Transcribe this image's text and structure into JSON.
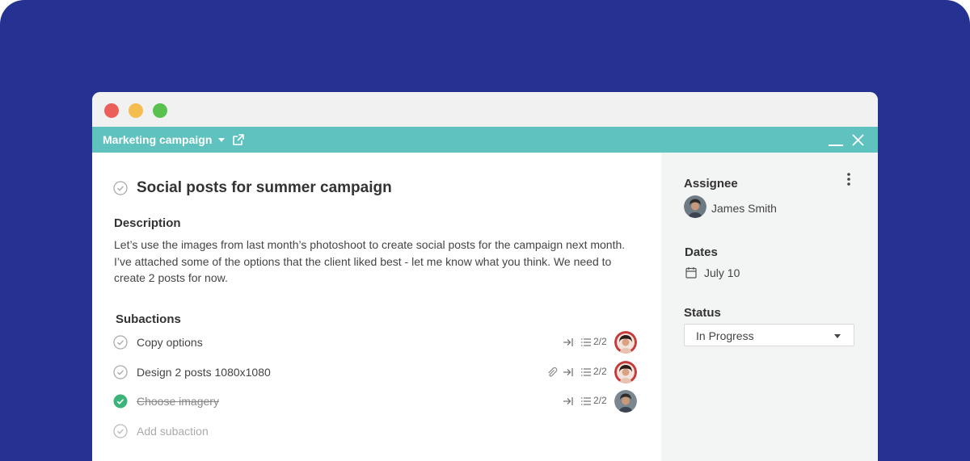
{
  "window": {
    "project_name": "Marketing campaign"
  },
  "task": {
    "title": "Social posts for summer campaign",
    "description_label": "Description",
    "description": "Let’s use the images from last month’s photoshoot to create social posts for the campaign next month. I’ve attached some of the options that the client liked best - let me know what you think. We need to create 2 posts for now."
  },
  "subactions": {
    "label": "Subactions",
    "items": [
      {
        "text": "Copy options",
        "count": "2/2",
        "done": false,
        "attachment": false
      },
      {
        "text": "Design 2 posts 1080x1080",
        "count": "2/2",
        "done": false,
        "attachment": true
      },
      {
        "text": "Choose imagery",
        "count": "2/2",
        "done": true,
        "attachment": false
      }
    ],
    "add_placeholder": "Add subaction"
  },
  "sidebar": {
    "assignee_label": "Assignee",
    "assignee_name": "James Smith",
    "dates_label": "Dates",
    "date_value": "July 10",
    "status_label": "Status",
    "status_value": "In Progress"
  },
  "colors": {
    "backdrop": "#253291",
    "toolbar": "#60c2bf",
    "done_check": "#3cb37a",
    "sidebar_bg": "#f3f4f4"
  },
  "icons": [
    "external-link-icon",
    "minimize-icon",
    "close-icon",
    "check-circle-icon",
    "arrow-in-icon",
    "list-icon",
    "paperclip-icon",
    "calendar-icon",
    "more-vertical-icon",
    "chevron-down-icon"
  ]
}
